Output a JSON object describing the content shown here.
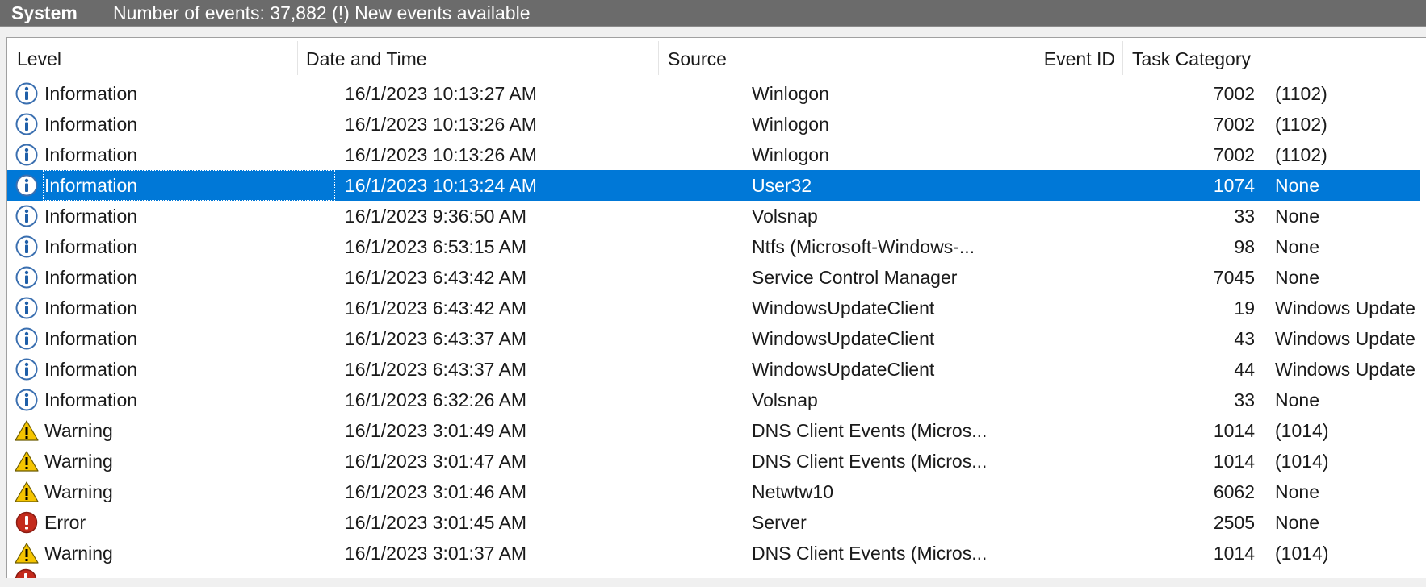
{
  "header": {
    "title": "System",
    "status": "Number of events: 37,882 (!) New events available"
  },
  "columns": {
    "level": "Level",
    "date": "Date and Time",
    "source": "Source",
    "event_id": "Event ID",
    "task": "Task Category"
  },
  "rows": [
    {
      "icon": "info",
      "level": "Information",
      "date": "16/1/2023 10:13:27 AM",
      "source": "Winlogon",
      "event_id": "7002",
      "task": "(1102)",
      "selected": false
    },
    {
      "icon": "info",
      "level": "Information",
      "date": "16/1/2023 10:13:26 AM",
      "source": "Winlogon",
      "event_id": "7002",
      "task": "(1102)",
      "selected": false
    },
    {
      "icon": "info",
      "level": "Information",
      "date": "16/1/2023 10:13:26 AM",
      "source": "Winlogon",
      "event_id": "7002",
      "task": "(1102)",
      "selected": false
    },
    {
      "icon": "info",
      "level": "Information",
      "date": "16/1/2023 10:13:24 AM",
      "source": "User32",
      "event_id": "1074",
      "task": "None",
      "selected": true
    },
    {
      "icon": "info",
      "level": "Information",
      "date": "16/1/2023 9:36:50 AM",
      "source": "Volsnap",
      "event_id": "33",
      "task": "None",
      "selected": false
    },
    {
      "icon": "info",
      "level": "Information",
      "date": "16/1/2023 6:53:15 AM",
      "source": "Ntfs (Microsoft-Windows-...",
      "event_id": "98",
      "task": "None",
      "selected": false
    },
    {
      "icon": "info",
      "level": "Information",
      "date": "16/1/2023 6:43:42 AM",
      "source": "Service Control Manager",
      "event_id": "7045",
      "task": "None",
      "selected": false
    },
    {
      "icon": "info",
      "level": "Information",
      "date": "16/1/2023 6:43:42 AM",
      "source": "WindowsUpdateClient",
      "event_id": "19",
      "task": "Windows Update",
      "selected": false
    },
    {
      "icon": "info",
      "level": "Information",
      "date": "16/1/2023 6:43:37 AM",
      "source": "WindowsUpdateClient",
      "event_id": "43",
      "task": "Windows Update",
      "selected": false
    },
    {
      "icon": "info",
      "level": "Information",
      "date": "16/1/2023 6:43:37 AM",
      "source": "WindowsUpdateClient",
      "event_id": "44",
      "task": "Windows Update",
      "selected": false
    },
    {
      "icon": "info",
      "level": "Information",
      "date": "16/1/2023 6:32:26 AM",
      "source": "Volsnap",
      "event_id": "33",
      "task": "None",
      "selected": false
    },
    {
      "icon": "warning",
      "level": "Warning",
      "date": "16/1/2023 3:01:49 AM",
      "source": "DNS Client Events (Micros...",
      "event_id": "1014",
      "task": "(1014)",
      "selected": false
    },
    {
      "icon": "warning",
      "level": "Warning",
      "date": "16/1/2023 3:01:47 AM",
      "source": "DNS Client Events (Micros...",
      "event_id": "1014",
      "task": "(1014)",
      "selected": false
    },
    {
      "icon": "warning",
      "level": "Warning",
      "date": "16/1/2023 3:01:46 AM",
      "source": "Netwtw10",
      "event_id": "6062",
      "task": "None",
      "selected": false
    },
    {
      "icon": "error",
      "level": "Error",
      "date": "16/1/2023 3:01:45 AM",
      "source": "Server",
      "event_id": "2505",
      "task": "None",
      "selected": false
    },
    {
      "icon": "warning",
      "level": "Warning",
      "date": "16/1/2023 3:01:37 AM",
      "source": "DNS Client Events (Micros...",
      "event_id": "1014",
      "task": "(1014)",
      "selected": false
    }
  ],
  "colors": {
    "header_bg": "#6b6b6b",
    "selection": "#0078d7",
    "info_icon": "#1f5fa8",
    "warning_icon": "#f5c400",
    "error_icon": "#c42b1c"
  }
}
